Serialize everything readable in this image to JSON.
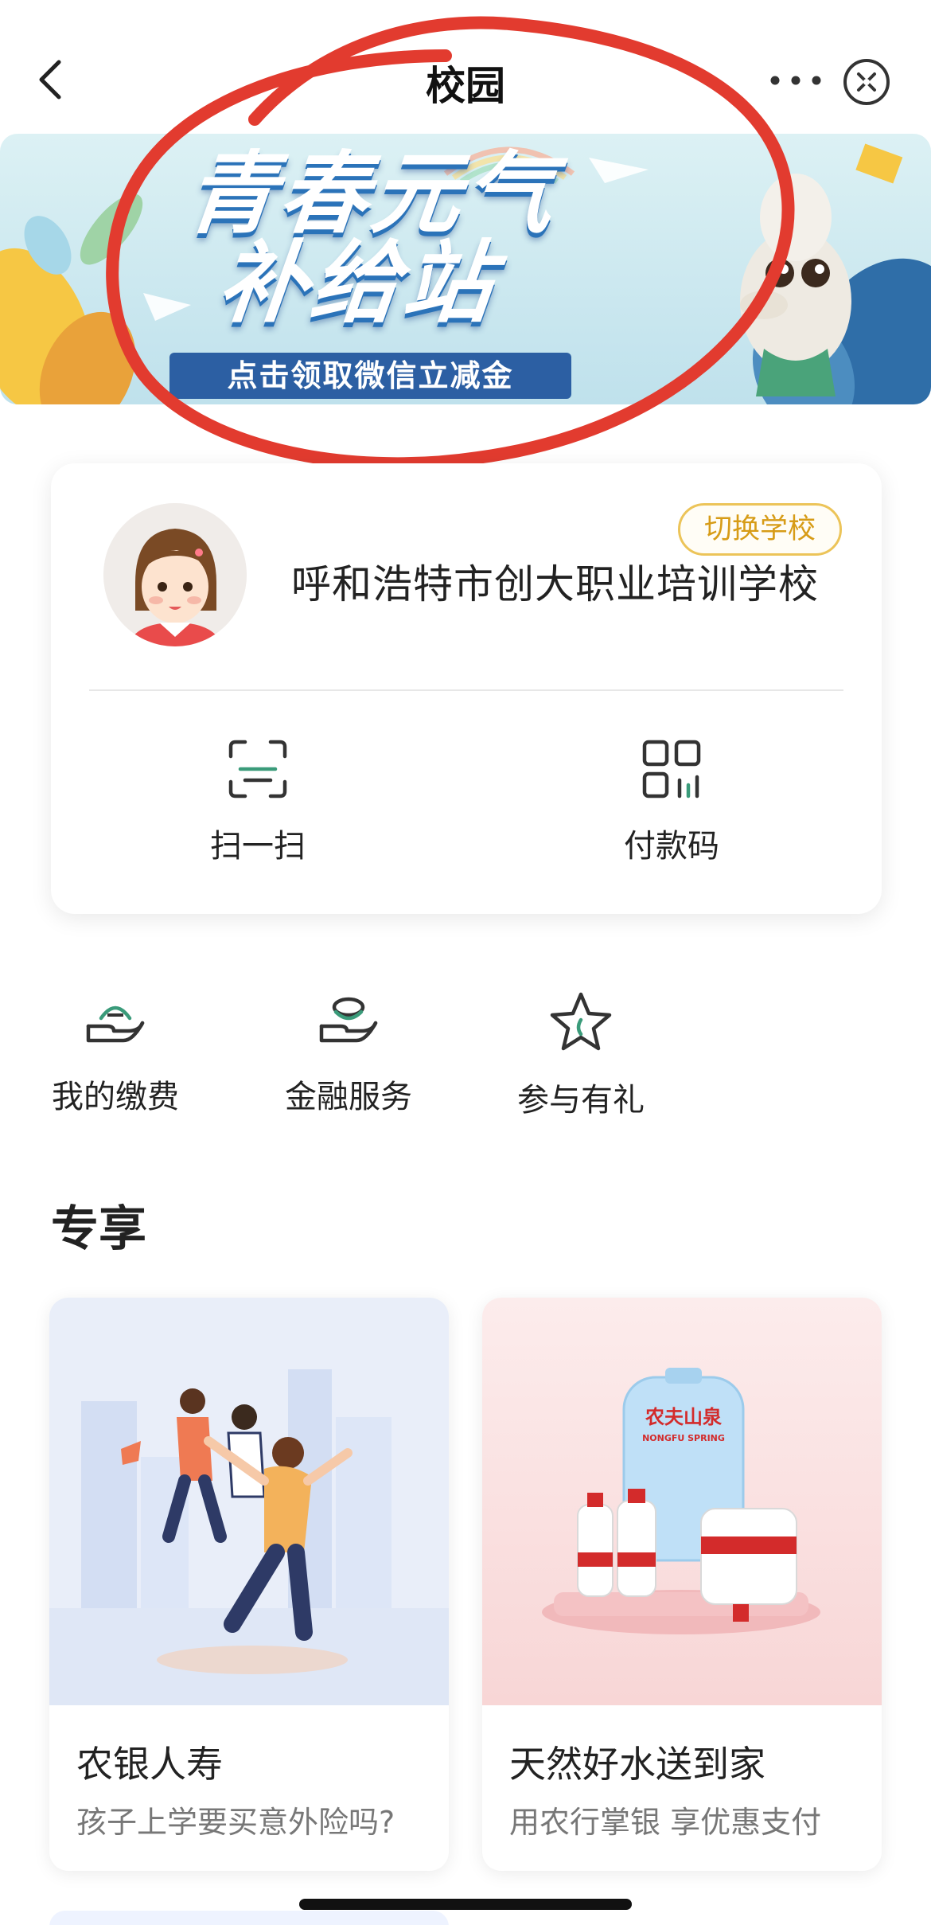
{
  "header": {
    "title": "校园",
    "back_icon": "chevron-left-icon",
    "more_icon": "more-dots-icon",
    "close_icon": "close-circle-icon"
  },
  "banner": {
    "title_line1": "青春元气",
    "title_line2": "补给站",
    "subtitle": "点击领取微信立减金",
    "colors": {
      "sky": "#cfe9f1",
      "subtitle_bg": "#2c5fa3",
      "annotation_circle": "#e23b2f"
    }
  },
  "school_card": {
    "avatar": "student-avatar",
    "switch_label": "切换学校",
    "school_name": "呼和浩特市创大职业培训学校",
    "actions": [
      {
        "label": "扫一扫",
        "icon": "scan-icon"
      },
      {
        "label": "付款码",
        "icon": "payment-code-icon"
      }
    ]
  },
  "quick_menu": [
    {
      "label": "我的缴费",
      "icon": "payment-hand-icon"
    },
    {
      "label": "金融服务",
      "icon": "finance-hand-icon"
    },
    {
      "label": "参与有礼",
      "icon": "star-icon"
    }
  ],
  "exclusive": {
    "title": "专享",
    "cards": [
      {
        "title": "农银人寿",
        "subtitle": "孩子上学要买意外险吗?",
        "image": "students-illustration"
      },
      {
        "title": "天然好水送到家",
        "subtitle": "用农行掌银 享优惠支付",
        "image": "water-bottles-illustration",
        "brand_cn": "农夫山泉",
        "brand_en": "NONGFU SPRING"
      }
    ]
  },
  "colors": {
    "accent_green": "#3a9b7a",
    "switch_border": "#ecc459",
    "switch_text": "#d79c17"
  }
}
